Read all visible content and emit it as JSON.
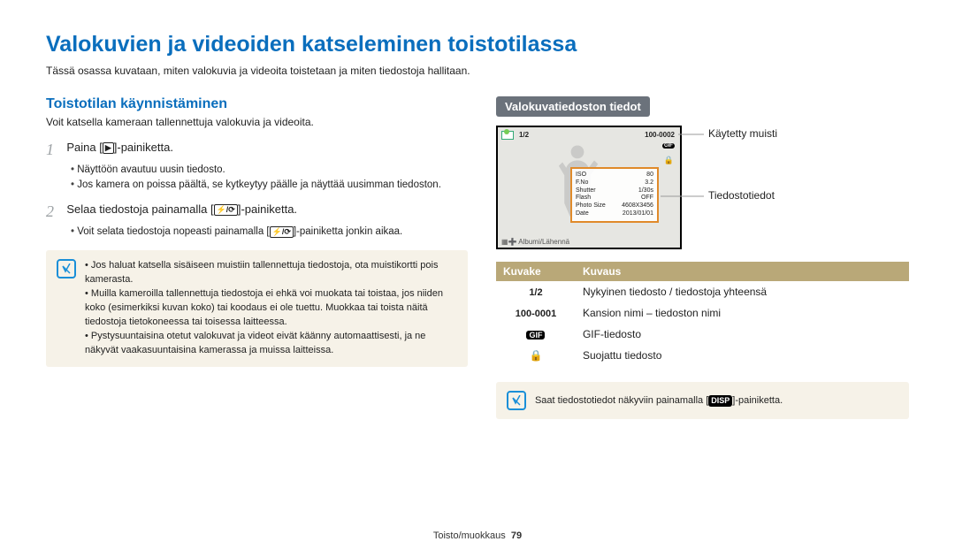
{
  "page": {
    "title": "Valokuvien ja videoiden katseleminen toistotilassa",
    "lead": "Tässä osassa kuvataan, miten valokuvia ja videoita toistetaan ja miten tiedostoja hallitaan."
  },
  "left": {
    "section_title": "Toistotilan käynnistäminen",
    "section_lead": "Voit katsella kameraan tallennettuja valokuvia ja videoita.",
    "step1": {
      "num": "1",
      "text_pre": "Paina [",
      "key": "▶",
      "text_post": "]-painiketta.",
      "bullets": [
        "Näyttöön avautuu uusin tiedosto.",
        "Jos kamera on poissa päältä, se kytkeytyy päälle ja näyttää uusimman tiedoston."
      ]
    },
    "step2": {
      "num": "2",
      "text_pre": "Selaa tiedostoja painamalla [",
      "key": "⚡/⟳",
      "text_post": "]-painiketta.",
      "bullets_pre": "Voit selata tiedostoja nopeasti painamalla [",
      "bullets_key": "⚡/⟳",
      "bullets_post": "]-painiketta jonkin aikaa."
    },
    "note": {
      "items": [
        "Jos haluat katsella sisäiseen muistiin tallennettuja tiedostoja, ota muistikortti pois kamerasta.",
        "Muilla kameroilla tallennettuja tiedostoja ei ehkä voi muokata tai toistaa, jos niiden koko (esimerkiksi kuvan koko) tai koodaus ei ole tuettu. Muokkaa tai toista näitä tiedostoja tietokoneessa tai toisessa laitteessa.",
        "Pystysuuntaisina otetut valokuvat ja videot eivät käänny automaattisesti, ja ne näkyvät vaakasuuntaisina kamerassa ja muissa laitteissa."
      ]
    }
  },
  "right": {
    "header": "Valokuvatiedoston tiedot",
    "callout_memory": "Käytetty muisti",
    "callout_fileinfo": "Tiedostotiedot",
    "screen": {
      "counter": "1/2",
      "filecode": "100-0002",
      "gif": "GIF",
      "help": "Albumi/Lähennä",
      "info": {
        "iso_k": "ISO",
        "iso_v": "80",
        "fno_k": "F.No",
        "fno_v": "3.2",
        "shutter_k": "Shutter",
        "shutter_v": "1/30s",
        "flash_k": "Flash",
        "flash_v": "OFF",
        "size_k": "Photo Size",
        "size_v": "4608X3456",
        "date_k": "Date",
        "date_v": "2013/01/01"
      }
    },
    "table": {
      "head_icon": "Kuvake",
      "head_desc": "Kuvaus",
      "rows": [
        {
          "icon": "1/2",
          "desc": "Nykyinen tiedosto / tiedostoja yhteensä"
        },
        {
          "icon": "100-0001",
          "desc": "Kansion nimi – tiedoston nimi"
        },
        {
          "icon": "GIF",
          "desc": "GIF-tiedosto"
        },
        {
          "icon": "🔒",
          "desc": "Suojattu tiedosto"
        }
      ]
    },
    "note2_pre": "Saat tiedostotiedot näkyviin painamalla [",
    "note2_key": "DISP",
    "note2_post": "]-painiketta."
  },
  "footer": {
    "section": "Toisto/muokkaus",
    "page": "79"
  }
}
